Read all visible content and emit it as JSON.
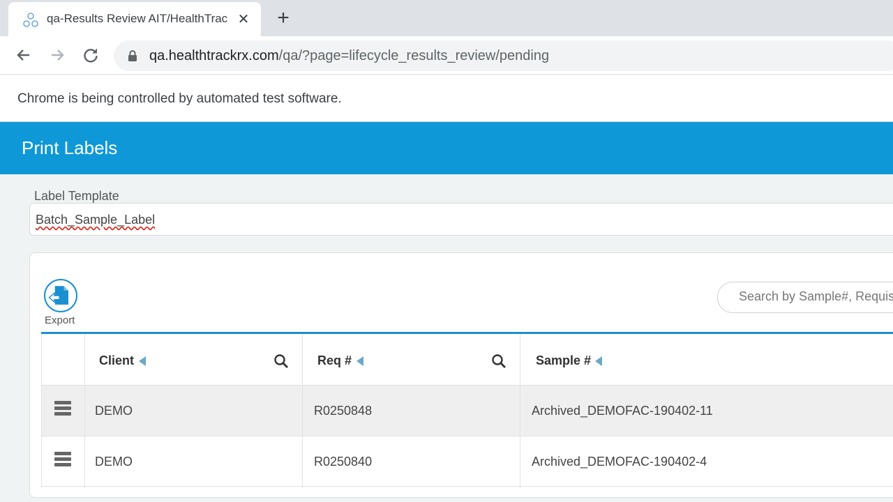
{
  "browser": {
    "tab_title": "qa-Results Review AIT/HealthTrac",
    "new_tab_symbol": "+",
    "close_symbol": "✕",
    "url_host": "qa.healthtrackrx.com",
    "url_path": "/qa/?page=lifecycle_results_review/pending",
    "infobar_text": "Chrome is being controlled by automated test software."
  },
  "modal": {
    "title": "Print Labels",
    "label_template_label": "Label Template",
    "label_template_value": "Batch_Sample_Label"
  },
  "toolbar": {
    "export_label": "Export",
    "search_placeholder": "Search by Sample#, Requisition#"
  },
  "table": {
    "columns": [
      "Client",
      "Req #",
      "Sample #"
    ],
    "rows": [
      {
        "client": "DEMO",
        "req": "R0250848",
        "sample": "Archived_DEMOFAC-190402-11"
      },
      {
        "client": "DEMO",
        "req": "R0250840",
        "sample": "Archived_DEMOFAC-190402-4"
      }
    ]
  },
  "colors": {
    "header_blue": "#0e98d7",
    "accent_blue": "#1a8fd2",
    "sort_arrow": "#6aa8c9"
  }
}
